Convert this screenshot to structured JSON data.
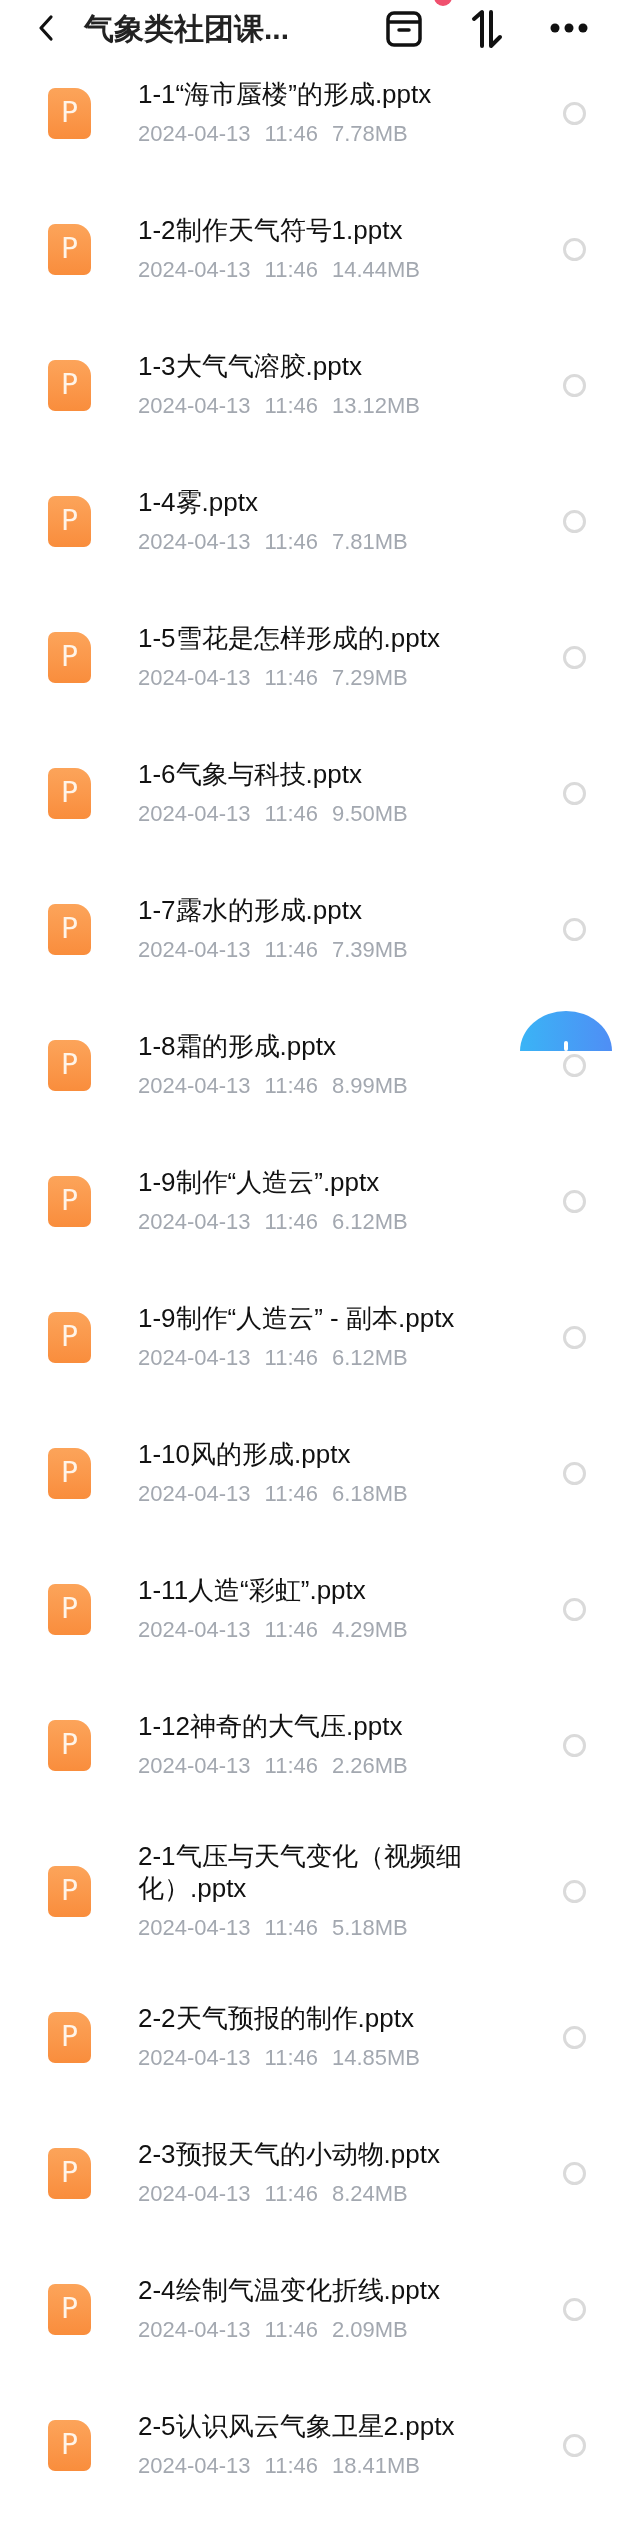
{
  "header": {
    "title": "气象类社团课..."
  },
  "files": [
    {
      "name": "1-1“海市蜃楼”的形成.pptx",
      "date": "2024-04-13",
      "time": "11:46",
      "size": "7.78MB",
      "icon_label": "P",
      "selected": false
    },
    {
      "name": "1-2制作天气符号1.pptx",
      "date": "2024-04-13",
      "time": "11:46",
      "size": "14.44MB",
      "icon_label": "P",
      "selected": false
    },
    {
      "name": "1-3大气气溶胶.pptx",
      "date": "2024-04-13",
      "time": "11:46",
      "size": "13.12MB",
      "icon_label": "P",
      "selected": false
    },
    {
      "name": "1-4雾.pptx",
      "date": "2024-04-13",
      "time": "11:46",
      "size": "7.81MB",
      "icon_label": "P",
      "selected": false
    },
    {
      "name": "1-5雪花是怎样形成的.pptx",
      "date": "2024-04-13",
      "time": "11:46",
      "size": "7.29MB",
      "icon_label": "P",
      "selected": false
    },
    {
      "name": "1-6气象与科技.pptx",
      "date": "2024-04-13",
      "time": "11:46",
      "size": "9.50MB",
      "icon_label": "P",
      "selected": false
    },
    {
      "name": "1-7露水的形成.pptx",
      "date": "2024-04-13",
      "time": "11:46",
      "size": "7.39MB",
      "icon_label": "P",
      "selected": false
    },
    {
      "name": "1-8霜的形成.pptx",
      "date": "2024-04-13",
      "time": "11:46",
      "size": "8.99MB",
      "icon_label": "P",
      "selected": false
    },
    {
      "name": "1-9制作“人造云”.pptx",
      "date": "2024-04-13",
      "time": "11:46",
      "size": "6.12MB",
      "icon_label": "P",
      "selected": false
    },
    {
      "name": "1-9制作“人造云” - 副本.pptx",
      "date": "2024-04-13",
      "time": "11:46",
      "size": "6.12MB",
      "icon_label": "P",
      "selected": false
    },
    {
      "name": "1-10风的形成.pptx",
      "date": "2024-04-13",
      "time": "11:46",
      "size": "6.18MB",
      "icon_label": "P",
      "selected": false
    },
    {
      "name": "1-11人造“彩虹”.pptx",
      "date": "2024-04-13",
      "time": "11:46",
      "size": "4.29MB",
      "icon_label": "P",
      "selected": false
    },
    {
      "name": "1-12神奇的大气压.pptx",
      "date": "2024-04-13",
      "time": "11:46",
      "size": "2.26MB",
      "icon_label": "P",
      "selected": false
    },
    {
      "name": "2-1气压与天气变化（视频细化）.pptx",
      "date": "2024-04-13",
      "time": "11:46",
      "size": "5.18MB",
      "icon_label": "P",
      "selected": false
    },
    {
      "name": "2-2天气预报的制作.pptx",
      "date": "2024-04-13",
      "time": "11:46",
      "size": "14.85MB",
      "icon_label": "P",
      "selected": false
    },
    {
      "name": "2-3预报天气的小动物.pptx",
      "date": "2024-04-13",
      "time": "11:46",
      "size": "8.24MB",
      "icon_label": "P",
      "selected": false
    },
    {
      "name": "2-4绘制气温变化折线.pptx",
      "date": "2024-04-13",
      "time": "11:46",
      "size": "2.09MB",
      "icon_label": "P",
      "selected": false
    },
    {
      "name": "2-5认识风云气象卫星2.pptx",
      "date": "2024-04-13",
      "time": "11:46",
      "size": "18.41MB",
      "icon_label": "P",
      "selected": false
    }
  ]
}
